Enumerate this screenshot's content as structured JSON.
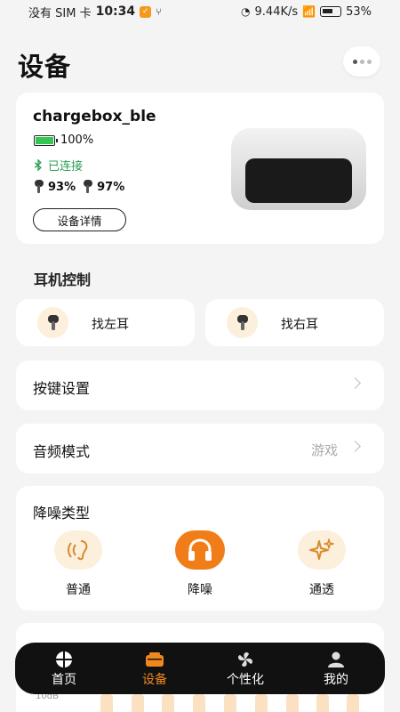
{
  "status_bar": {
    "carrier": "没有 SIM 卡",
    "time": "10:34",
    "net_speed": "9.44K/s",
    "battery": "53%"
  },
  "header": {
    "title": "设备"
  },
  "device": {
    "name": "chargebox_ble",
    "battery": "100%",
    "connection": "已连接",
    "left_ear": "93%",
    "right_ear": "97%",
    "detail_button": "设备详情"
  },
  "earphone_control": {
    "title": "耳机控制",
    "find_left": "找左耳",
    "find_right": "找右耳"
  },
  "key_settings": {
    "label": "按键设置"
  },
  "audio_mode": {
    "label": "音频模式",
    "value": "游戏"
  },
  "anc": {
    "title": "降噪类型",
    "options": [
      {
        "label": "普通",
        "icon": "ear-wave-icon"
      },
      {
        "label": "降噪",
        "icon": "headphones-icon"
      },
      {
        "label": "通透",
        "icon": "sparkle-icon"
      }
    ]
  },
  "equalizer": {
    "scale_label": "10dB"
  },
  "nav": {
    "items": [
      {
        "label": "首页",
        "icon": "grid-icon"
      },
      {
        "label": "设备",
        "icon": "case-icon"
      },
      {
        "label": "个性化",
        "icon": "pinwheel-icon"
      },
      {
        "label": "我的",
        "icon": "user-icon"
      }
    ],
    "active_index": 1
  },
  "colors": {
    "accent": "#f07d18",
    "connected": "#2e9d55",
    "battery": "#36c552",
    "nav_bg": "#111111"
  }
}
